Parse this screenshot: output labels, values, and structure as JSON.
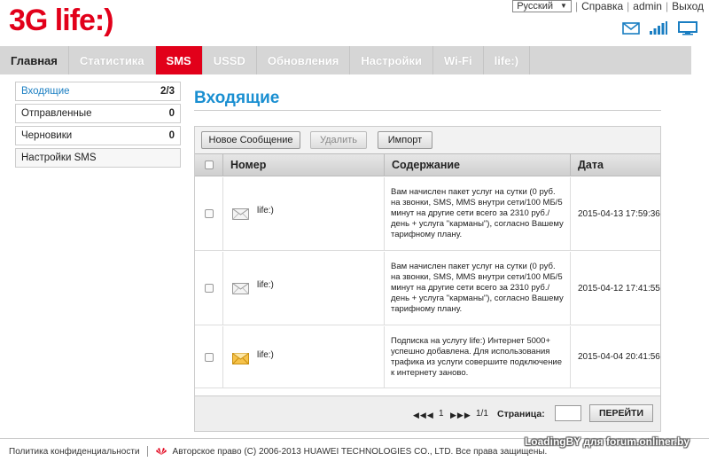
{
  "header": {
    "logo_text": "3G life:)",
    "language": "Русский",
    "help_label": "Справка",
    "user_label": "admin",
    "logout_label": "Выход"
  },
  "nav": {
    "items": [
      {
        "label": "Главная"
      },
      {
        "label": "Статистика"
      },
      {
        "label": "SMS"
      },
      {
        "label": "USSD"
      },
      {
        "label": "Обновления"
      },
      {
        "label": "Настройки"
      },
      {
        "label": "Wi-Fi"
      },
      {
        "label": "life:)"
      }
    ],
    "active": "SMS"
  },
  "sidebar": {
    "items": [
      {
        "label": "Входящие",
        "count": "2/3"
      },
      {
        "label": "Отправленные",
        "count": "0"
      },
      {
        "label": "Черновики",
        "count": "0"
      },
      {
        "label": "Настройки SMS",
        "count": ""
      }
    ]
  },
  "main": {
    "title": "Входящие",
    "toolbar": {
      "new_label": "Новое Сообщение",
      "delete_label": "Удалить",
      "import_label": "Импорт"
    },
    "columns": [
      "Номер",
      "Содержание",
      "Дата"
    ],
    "messages": [
      {
        "sender": "life:)",
        "content": "Вам начислен пакет услуг на сутки (0 руб. на звонки, SMS, MMS внутри сети/100 МБ/5 минут на другие сети всего за 2310 руб./ день + услуга \"карманы\"), согласно Вашему тарифному плану.",
        "date": "2015-04-13 17:59:36",
        "icon": "envelope-read-icon",
        "read": true
      },
      {
        "sender": "life:)",
        "content": "Вам начислен пакет услуг на сутки (0 руб. на звонки, SMS, MMS внутри сети/100 МБ/5 минут на другие сети всего за 2310 руб./ день + услуга \"карманы\"), согласно Вашему тарифному плану.",
        "date": "2015-04-12 17:41:55",
        "icon": "envelope-read-icon",
        "read": true
      },
      {
        "sender": "life:)",
        "content": "Подписка на услугу life:) Интернет 5000+ успешно добавлена. Для использования трафика из услуги совершите подключение к интернету заново.",
        "date": "2015-04-04 20:41:56",
        "icon": "envelope-unread-icon",
        "read": false
      }
    ],
    "pager": {
      "current": "1",
      "total": "1/1",
      "page_label": "Страница:",
      "go_label": "ПЕРЕЙТИ"
    }
  },
  "footer": {
    "privacy": "Политика конфиденциальности",
    "copyright": "Авторское право (C) 2006-2013 HUAWEI TECHNOLOGIES CO., LTD. Все права защищены.",
    "watermark": "LoadingBY для forum.onliner.by"
  },
  "colors": {
    "brand_red": "#e2001a",
    "title_blue": "#1a8fd1",
    "icon_blue": "#1a7ec2"
  }
}
